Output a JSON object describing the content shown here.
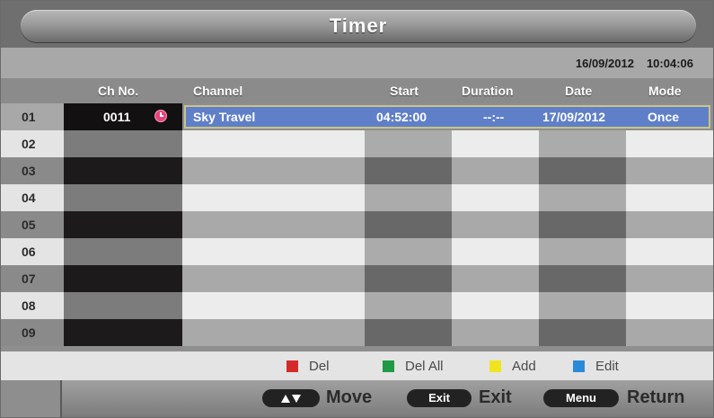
{
  "title": "Timer",
  "datetime": {
    "date": "16/09/2012",
    "time": "10:04:06"
  },
  "columns": {
    "ch_no": "Ch No.",
    "channel": "Channel",
    "start": "Start",
    "duration": "Duration",
    "date": "Date",
    "mode": "Mode"
  },
  "rows": [
    {
      "num": "01",
      "ch_no": "0011",
      "channel": "Sky Travel",
      "start": "04:52:00",
      "duration": "--:--",
      "date": "17/09/2012",
      "mode": "Once"
    },
    {
      "num": "02"
    },
    {
      "num": "03"
    },
    {
      "num": "04"
    },
    {
      "num": "05"
    },
    {
      "num": "06"
    },
    {
      "num": "07"
    },
    {
      "num": "08"
    },
    {
      "num": "09"
    }
  ],
  "legend": [
    {
      "label": "Del",
      "color": "#d42a2a"
    },
    {
      "label": "Del All",
      "color": "#1f9a45"
    },
    {
      "label": "Add",
      "color": "#f0e51c"
    },
    {
      "label": "Edit",
      "color": "#2a8ad8"
    }
  ],
  "nav": {
    "move_label": "Move",
    "exit_key": "Exit",
    "exit_label": "Exit",
    "menu_key": "Menu",
    "menu_label": "Return"
  },
  "icons": {
    "row1_status": "clock-icon"
  }
}
